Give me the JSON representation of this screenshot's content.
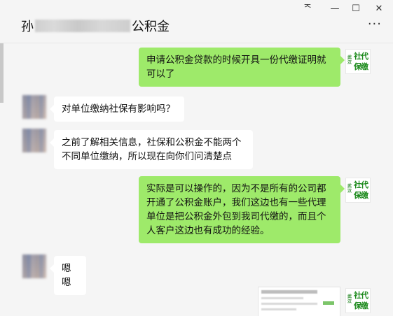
{
  "window": {
    "controls": {
      "pin": "ᅐ",
      "minimize": "—",
      "maximize": "☐",
      "close": "✕"
    },
    "more_label": "···"
  },
  "header": {
    "name_prefix": "孙",
    "name_suffix": "公积金"
  },
  "logo": {
    "small_text": "武汉",
    "big_text": "社代保缴",
    "color": "#1c8a1c"
  },
  "colors": {
    "out_bubble": "#9eea6a",
    "in_bubble": "#ffffff",
    "background": "#f5f5f5"
  },
  "messages": [
    {
      "sender": "me",
      "text": "申请公积金贷款的时候开具一份代缴证明就可以了"
    },
    {
      "sender": "contact",
      "text": "对单位缴纳社保有影响吗？"
    },
    {
      "sender": "contact",
      "text": "之前了解相关信息，社保和公积金不能两个不同单位缴纳，所以现在向你们问清楚点"
    },
    {
      "sender": "me",
      "text": "实际是可以操作的，因为不是所有的公司都开通了公积金账户，我们这边也有一些代理单位是把公积金外包到我司代缴的，而且个人客户这边也有成功的经验。"
    },
    {
      "sender": "contact",
      "text": "嗯嗯"
    },
    {
      "sender": "me",
      "type": "image"
    }
  ]
}
